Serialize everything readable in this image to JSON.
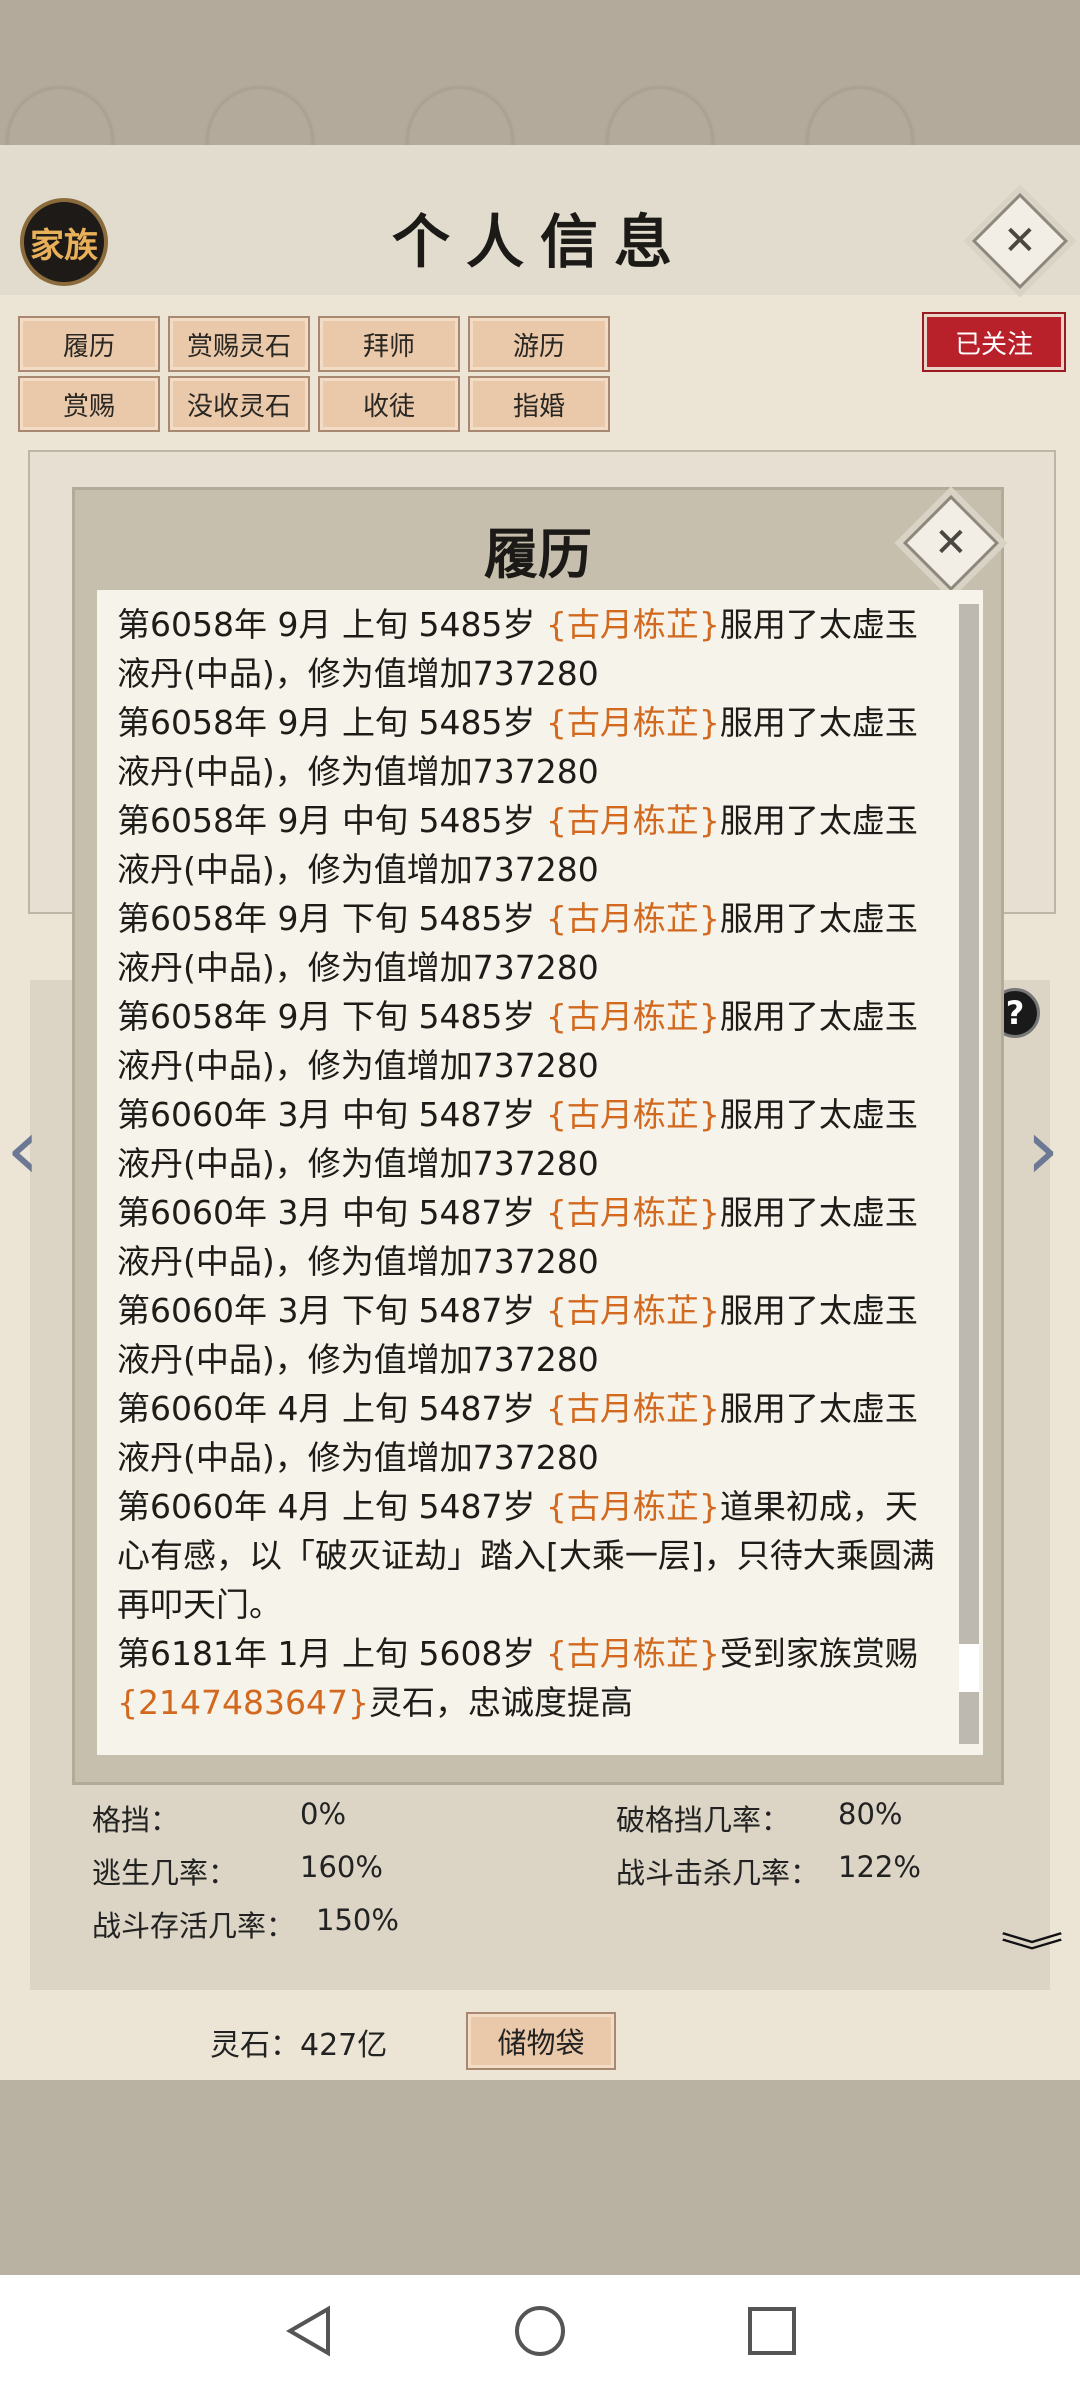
{
  "header": {
    "family_label": "家族",
    "title": "个人信息"
  },
  "actions": {
    "row1": [
      "履历",
      "赏赐灵石",
      "拜师",
      "游历"
    ],
    "row2": [
      "赏赐",
      "没收灵石",
      "收徒",
      "指婚"
    ],
    "followed_label": "已关注"
  },
  "modal": {
    "title": "履历",
    "entries": [
      {
        "prefix": "第6058年 9月 上旬 5485岁 ",
        "name": "{古月栋芷}",
        "suffix": "服用了太虚玉液丹(中品)，修为值增加737280"
      },
      {
        "prefix": "第6058年 9月 上旬 5485岁 ",
        "name": "{古月栋芷}",
        "suffix": "服用了太虚玉液丹(中品)，修为值增加737280"
      },
      {
        "prefix": "第6058年 9月 中旬 5485岁 ",
        "name": "{古月栋芷}",
        "suffix": "服用了太虚玉液丹(中品)，修为值增加737280"
      },
      {
        "prefix": "第6058年 9月 下旬 5485岁 ",
        "name": "{古月栋芷}",
        "suffix": "服用了太虚玉液丹(中品)，修为值增加737280"
      },
      {
        "prefix": "第6058年 9月 下旬 5485岁 ",
        "name": "{古月栋芷}",
        "suffix": "服用了太虚玉液丹(中品)，修为值增加737280"
      },
      {
        "prefix": "第6060年 3月 中旬 5487岁 ",
        "name": "{古月栋芷}",
        "suffix": "服用了太虚玉液丹(中品)，修为值增加737280"
      },
      {
        "prefix": "第6060年 3月 中旬 5487岁 ",
        "name": "{古月栋芷}",
        "suffix": "服用了太虚玉液丹(中品)，修为值增加737280"
      },
      {
        "prefix": "第6060年 3月 下旬 5487岁 ",
        "name": "{古月栋芷}",
        "suffix": "服用了太虚玉液丹(中品)，修为值增加737280"
      },
      {
        "prefix": "第6060年 4月 上旬 5487岁 ",
        "name": "{古月栋芷}",
        "suffix": "服用了太虚玉液丹(中品)，修为值增加737280"
      },
      {
        "prefix": "第6060年 4月 上旬 5487岁 ",
        "name": "{古月栋芷}",
        "suffix": "道果初成，天心有感，以「破灭证劫」踏入[大乘一层]，只待大乘圆满再叩天门。"
      },
      {
        "prefix": "第6181年 1月 上旬  5608岁  ",
        "name": "{古月栋芷}",
        "suffix": "受到家族赏赐",
        "extra_orange": "{2147483647}",
        "extra_suffix": "灵石，忠诚度提高"
      }
    ]
  },
  "stats": {
    "block_label": "格挡：",
    "block_value": "0%",
    "break_block_label": "破格挡几率：",
    "break_block_value": "80%",
    "escape_label": "逃生几率：",
    "escape_value": "160%",
    "kill_label": "战斗击杀几率：",
    "kill_value": "122%",
    "survive_label": "战斗存活几率：",
    "survive_value": "150%"
  },
  "footer": {
    "spirit_stones": "灵石：427亿",
    "bag_label": "储物袋"
  },
  "colors": {
    "accent_orange": "#d2691e",
    "followed_red": "#b8202a",
    "button_fill": "#e9c9aa"
  },
  "icons": {
    "close": "close-icon",
    "left": "chevron-left-icon",
    "right": "chevron-right-icon",
    "help": "help-icon",
    "expand": "chevron-down-icon"
  }
}
